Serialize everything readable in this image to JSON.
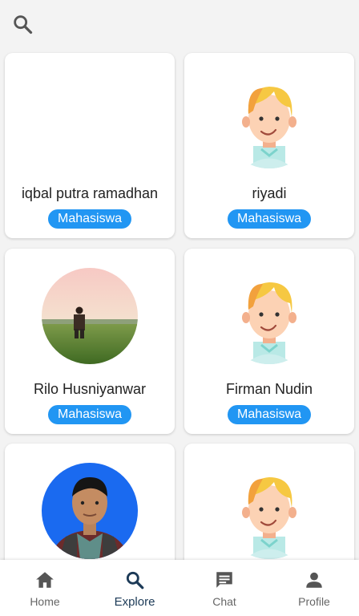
{
  "search": {
    "icon": "search-icon"
  },
  "users": [
    {
      "name": "iqbal putra ramadhan",
      "role": "Mahasiswa",
      "avatar": "none"
    },
    {
      "name": "riyadi",
      "role": "Mahasiswa",
      "avatar": "cartoon-boy-icon"
    },
    {
      "name": "Rilo Husniyanwar",
      "role": "Mahasiswa",
      "avatar": "field-photo"
    },
    {
      "name": "Firman Nudin",
      "role": "Mahasiswa",
      "avatar": "cartoon-boy-icon"
    },
    {
      "name": "",
      "role": "",
      "avatar": "portrait-photo"
    },
    {
      "name": "",
      "role": "",
      "avatar": "cartoon-boy-icon"
    }
  ],
  "nav": {
    "items": [
      {
        "label": "Home",
        "icon": "home-icon"
      },
      {
        "label": "Explore",
        "icon": "search-icon"
      },
      {
        "label": "Chat",
        "icon": "chat-icon"
      },
      {
        "label": "Profile",
        "icon": "person-icon"
      }
    ],
    "active": "Explore"
  },
  "colors": {
    "badge": "#2196f3",
    "active_nav": "#1c3a57",
    "background": "#f3f3f3"
  }
}
